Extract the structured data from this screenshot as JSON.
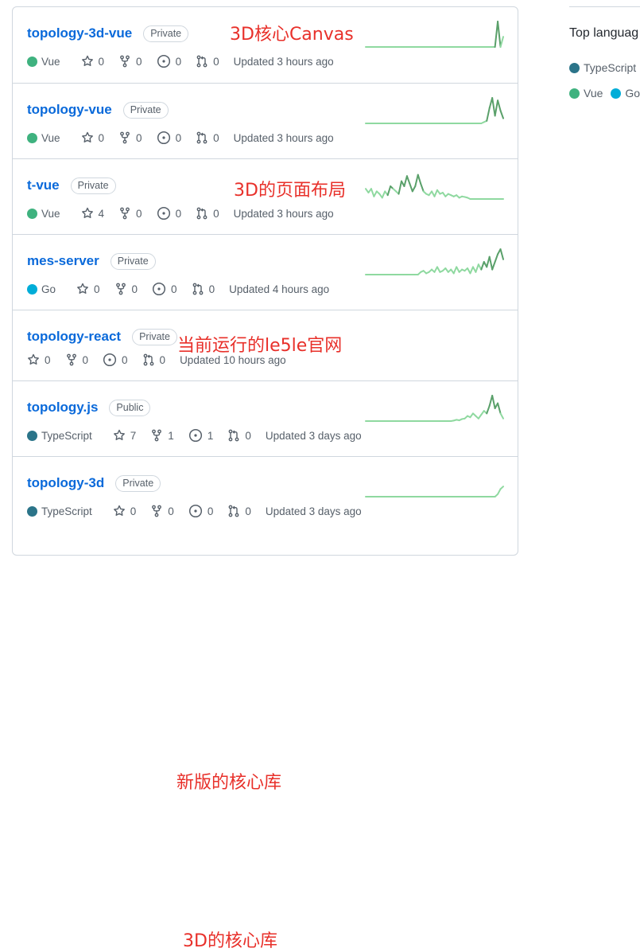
{
  "colors": {
    "vue": "#3fb27f",
    "go": "#00add8",
    "typescript": "#2b7489",
    "link": "#0969da",
    "annotation": "#e8302a",
    "spark_light": "#9be9a8",
    "spark_dark": "#40c463"
  },
  "repos": [
    {
      "name": "topology-3d-vue",
      "visibility": "Private",
      "annotation": "3D核心Canvas",
      "language": "Vue",
      "language_color": "#3fb27f",
      "stars": "0",
      "forks": "0",
      "issues": "0",
      "pulls": "0",
      "updated": "Updated 3 hours ago",
      "activity": [
        0,
        0,
        0,
        0,
        0,
        0,
        0,
        0,
        0,
        0,
        0,
        0,
        0,
        0,
        0,
        0,
        0,
        0,
        0,
        0,
        0,
        0,
        0,
        0,
        0,
        0,
        0,
        0,
        0,
        0,
        0,
        0,
        0,
        0,
        0,
        0,
        0,
        0,
        0,
        0,
        0,
        0,
        0,
        0,
        0,
        0,
        0,
        0,
        1,
        0,
        0.4
      ]
    },
    {
      "name": "topology-vue",
      "visibility": "Private",
      "annotation": "3D的页面布局",
      "language": "Vue",
      "language_color": "#3fb27f",
      "stars": "0",
      "forks": "0",
      "issues": "0",
      "pulls": "0",
      "updated": "Updated 3 hours ago",
      "activity": [
        0,
        0,
        0,
        0,
        0,
        0,
        0,
        0,
        0,
        0,
        0,
        0,
        0,
        0,
        0,
        0,
        0,
        0,
        0,
        0,
        0,
        0,
        0,
        0,
        0,
        0,
        0,
        0,
        0,
        0,
        0,
        0,
        0,
        0,
        0,
        0,
        0,
        0,
        0,
        0,
        0,
        0,
        0,
        0.05,
        0.1,
        0.6,
        1,
        0.3,
        0.9,
        0.5,
        0.2
      ]
    },
    {
      "name": "t-vue",
      "visibility": "Private",
      "annotation": "当前运行的le5le官网",
      "language": "Vue",
      "language_color": "#3fb27f",
      "stars": "4",
      "forks": "0",
      "issues": "0",
      "pulls": "0",
      "updated": "Updated 3 hours ago",
      "activity": [
        0.4,
        0.25,
        0.4,
        0.1,
        0.3,
        0.2,
        0.05,
        0.3,
        0.15,
        0.5,
        0.4,
        0.3,
        0.2,
        0.7,
        0.5,
        0.9,
        0.6,
        0.3,
        0.5,
        0.95,
        0.6,
        0.3,
        0.2,
        0.15,
        0.3,
        0.1,
        0.35,
        0.2,
        0.25,
        0.1,
        0.2,
        0.15,
        0.1,
        0.15,
        0.05,
        0.1,
        0.08,
        0.05,
        0,
        0,
        0,
        0,
        0,
        0,
        0,
        0,
        0,
        0,
        0,
        0,
        0
      ]
    },
    {
      "name": "mes-server",
      "visibility": "Private",
      "annotation": "",
      "language": "Go",
      "language_color": "#00add8",
      "stars": "0",
      "forks": "0",
      "issues": "0",
      "pulls": "0",
      "updated": "Updated 4 hours ago",
      "activity": [
        0,
        0,
        0,
        0,
        0,
        0,
        0,
        0,
        0,
        0,
        0,
        0,
        0,
        0,
        0,
        0,
        0,
        0,
        0,
        0,
        0.1,
        0.15,
        0.05,
        0.1,
        0.2,
        0.1,
        0.3,
        0.1,
        0.15,
        0.25,
        0.1,
        0.2,
        0.05,
        0.3,
        0.1,
        0.2,
        0.15,
        0.25,
        0.05,
        0.3,
        0.1,
        0.4,
        0.2,
        0.5,
        0.3,
        0.7,
        0.2,
        0.5,
        0.8,
        1,
        0.6
      ]
    },
    {
      "name": "topology-react",
      "visibility": "Private",
      "annotation": "",
      "language": "",
      "language_color": "",
      "stars": "0",
      "forks": "0",
      "issues": "0",
      "pulls": "0",
      "updated": "Updated 10 hours ago",
      "activity": []
    },
    {
      "name": "topology.js",
      "visibility": "Public",
      "annotation": "新版的核心库",
      "language": "TypeScript",
      "language_color": "#2b7489",
      "stars": "7",
      "forks": "1",
      "issues": "1",
      "pulls": "0",
      "updated": "Updated 3 days ago",
      "activity": [
        0,
        0,
        0,
        0,
        0,
        0,
        0,
        0,
        0,
        0,
        0,
        0,
        0,
        0,
        0,
        0,
        0,
        0,
        0,
        0,
        0,
        0,
        0,
        0,
        0,
        0,
        0,
        0,
        0,
        0,
        0,
        0,
        0.02,
        0.05,
        0.03,
        0.08,
        0.1,
        0.2,
        0.15,
        0.3,
        0.2,
        0.1,
        0.25,
        0.4,
        0.3,
        0.6,
        1,
        0.5,
        0.7,
        0.3,
        0.1
      ]
    },
    {
      "name": "topology-3d",
      "visibility": "Private",
      "annotation": "3D的核心库",
      "language": "TypeScript",
      "language_color": "#2b7489",
      "stars": "0",
      "forks": "0",
      "issues": "0",
      "pulls": "0",
      "updated": "Updated 3 days ago",
      "activity": [
        0,
        0,
        0,
        0,
        0,
        0,
        0,
        0,
        0,
        0,
        0,
        0,
        0,
        0,
        0,
        0,
        0,
        0,
        0,
        0,
        0,
        0,
        0,
        0,
        0,
        0,
        0,
        0,
        0,
        0,
        0,
        0,
        0,
        0,
        0,
        0,
        0,
        0,
        0,
        0,
        0,
        0,
        0,
        0,
        0,
        0,
        0,
        0,
        0.1,
        0.3,
        0.4
      ]
    }
  ],
  "sidebar": {
    "top_languages_title": "Top languag",
    "languages": [
      {
        "name": "TypeScript",
        "color": "#2b7489"
      },
      {
        "name": "Vue",
        "color": "#3fb27f"
      },
      {
        "name": "Go",
        "color": "#00add8"
      }
    ]
  }
}
